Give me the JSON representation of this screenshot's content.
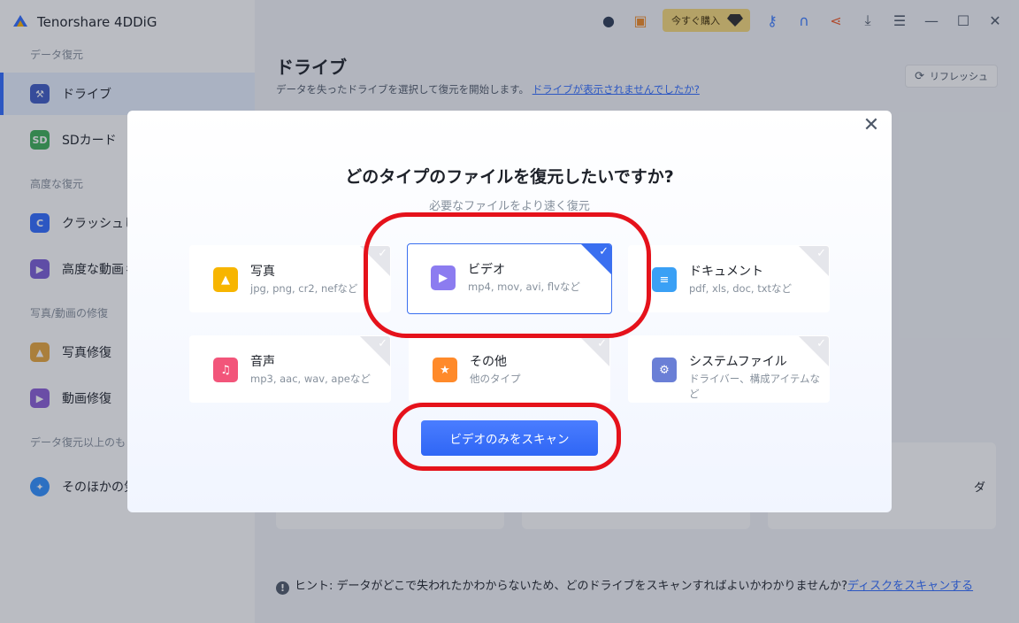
{
  "app": {
    "title": "Tenorshare 4DDiG"
  },
  "sidebar": {
    "sections": [
      {
        "title": "データ復元"
      },
      {
        "title": "高度な復元"
      },
      {
        "title": "写真/動画の修復"
      },
      {
        "title": "データ復元以上のも"
      }
    ],
    "items": [
      {
        "label": "ドライブ",
        "icon": "drive-icon"
      },
      {
        "label": "SDカード",
        "icon": "sd-card-icon"
      },
      {
        "label": "クラッシュし",
        "icon": "crashed-pc-icon"
      },
      {
        "label": "高度な動画彳",
        "icon": "advanced-video-icon"
      },
      {
        "label": "写真修復",
        "icon": "photo-repair-icon"
      },
      {
        "label": "動画修復",
        "icon": "video-repair-icon"
      },
      {
        "label": "そのほかの気",
        "icon": "compass-icon"
      }
    ]
  },
  "topbar": {
    "buy_label": "今すぐ購入"
  },
  "main": {
    "title": "ドライブ",
    "subtitle": "データを失ったドライブを選択して復元を開始します。",
    "subtitle_link": "ドライブが表示されませんでしたか?",
    "refresh_label": "リフレッシュ",
    "card_text": "ダ",
    "hint_prefix": "ヒント: データがどこで失われたかわからないため、どのドライブをスキャンすればよいかわかりませんか?",
    "hint_link": "ディスクをスキャンする"
  },
  "modal": {
    "title": "どのタイプのファイルを復元したいですか?",
    "subtitle": "必要なファイルをより速く復元",
    "types": [
      {
        "name": "写真",
        "desc": "jpg, png, cr2, nefなど",
        "icon": "image-icon",
        "color": "#f7b500",
        "selected": false
      },
      {
        "name": "ビデオ",
        "desc": "mp4, mov, avi, flvなど",
        "icon": "play-icon",
        "color": "#8c7cf0",
        "selected": true
      },
      {
        "name": "ドキュメント",
        "desc": "pdf, xls, doc, txtなど",
        "icon": "document-icon",
        "color": "#3aa0f5",
        "selected": false
      },
      {
        "name": "音声",
        "desc": "mp3, aac, wav, apeなど",
        "icon": "music-icon",
        "color": "#f2557a",
        "selected": false
      },
      {
        "name": "その他",
        "desc": "他のタイプ",
        "icon": "star-icon",
        "color": "#ff8a2a",
        "selected": false
      },
      {
        "name": "システムファイル",
        "desc": "ドライバー、構成アイテムなど",
        "icon": "gear-icon",
        "color": "#6a7fd6",
        "selected": false
      }
    ],
    "scan_label": "ビデオのみをスキャン"
  }
}
